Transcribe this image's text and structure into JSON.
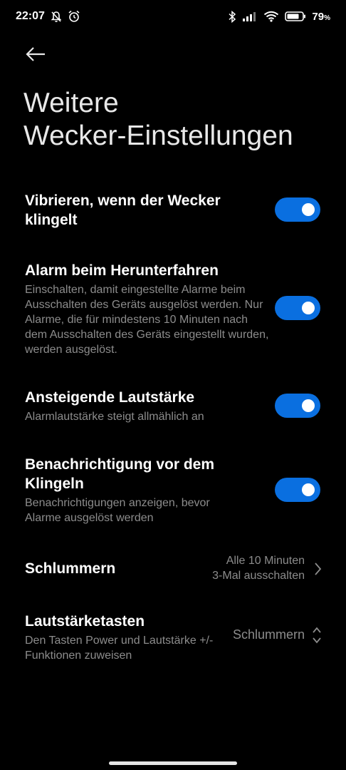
{
  "status_bar": {
    "time": "22:07",
    "battery_level": "79",
    "battery_unit": "%"
  },
  "header": {
    "title_line1": "Weitere",
    "title_line2": "Wecker-Einstellungen"
  },
  "settings": [
    {
      "title": "Vibrieren, wenn der Wecker klingelt",
      "subtitle": "",
      "enabled": true
    },
    {
      "title": "Alarm beim Herunterfahren",
      "subtitle": "Einschalten, damit eingestellte Alarme beim Ausschalten des Geräts ausgelöst werden. Nur Alarme, die für mindestens 10 Minuten nach dem Ausschalten des Geräts eingestellt wurden, werden ausgelöst.",
      "enabled": true
    },
    {
      "title": "Ansteigende Lautstärke",
      "subtitle": "Alarmlautstärke steigt allmählich an",
      "enabled": true
    },
    {
      "title": "Benachrichtigung vor dem Klingeln",
      "subtitle": "Benachrichtigungen anzeigen, bevor Alarme ausgelöst werden",
      "enabled": true
    }
  ],
  "snooze": {
    "title": "Schlummern",
    "value_line1": "Alle 10 Minuten",
    "value_line2": "3-Mal ausschalten"
  },
  "volume_keys": {
    "title": "Lautstärketasten",
    "subtitle": "Den Tasten Power und Lautstärke +/- Funktionen zuweisen",
    "value": "Schlummern"
  },
  "colors": {
    "background": "#000000",
    "toggle_on": "#0a6fe0",
    "secondary_text": "#8c8c8c"
  }
}
